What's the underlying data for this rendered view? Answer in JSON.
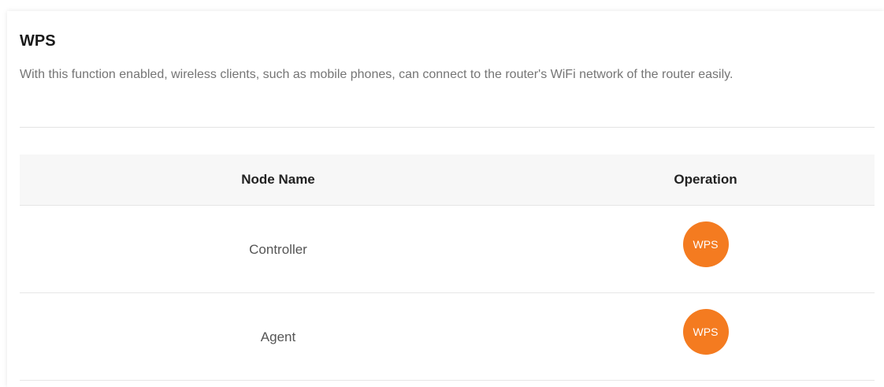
{
  "section": {
    "title": "WPS",
    "description": "With this function enabled, wireless clients, such as mobile phones, can connect to the router's WiFi network of the router easily."
  },
  "table": {
    "headers": {
      "node_name": "Node Name",
      "operation": "Operation"
    },
    "rows": [
      {
        "node_name": "Controller",
        "button_label": "WPS"
      },
      {
        "node_name": "Agent",
        "button_label": "WPS"
      }
    ]
  },
  "colors": {
    "accent": "#f47b20"
  }
}
